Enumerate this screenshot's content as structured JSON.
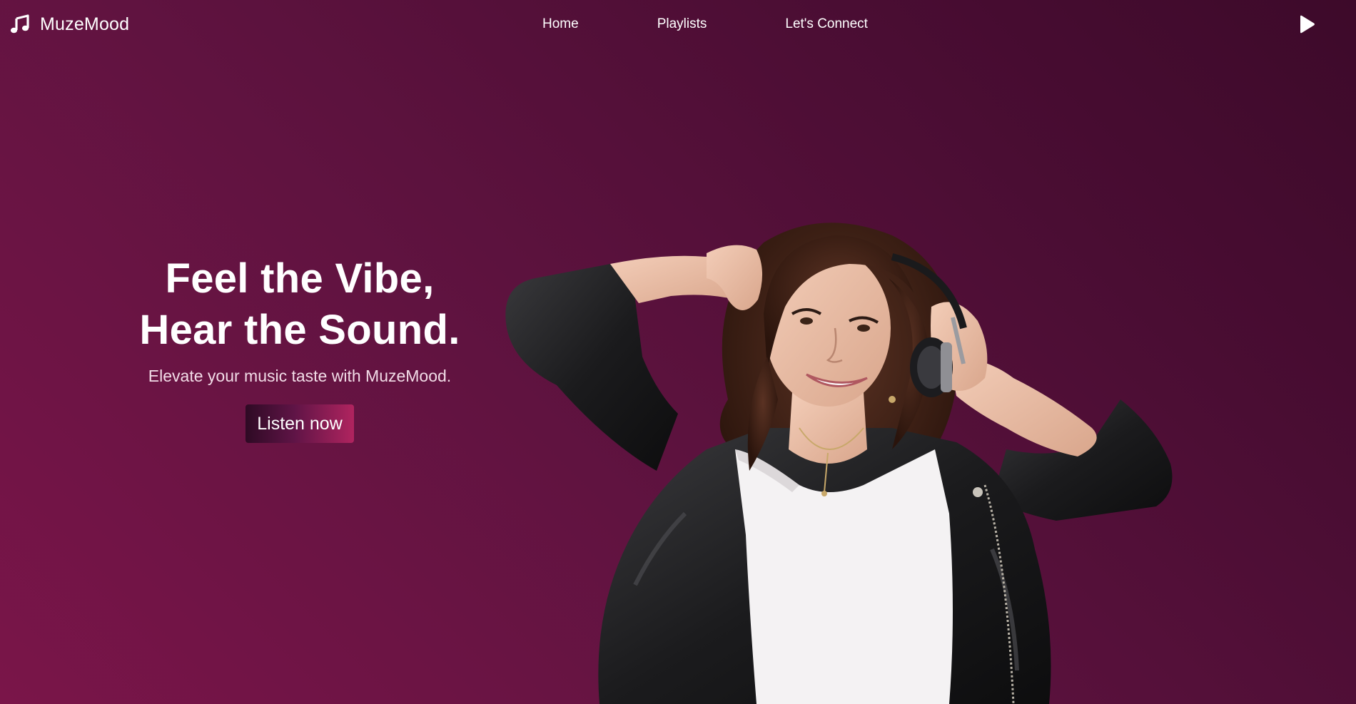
{
  "brand": {
    "name": "MuzeMood",
    "icon": "music-note-icon"
  },
  "nav": {
    "links": [
      {
        "label": "Home"
      },
      {
        "label": "Playlists"
      },
      {
        "label": "Let's Connect"
      }
    ],
    "play_icon": "play-icon"
  },
  "hero": {
    "title_line1": "Feel the Vibe,",
    "title_line2": "Hear the Sound.",
    "subtitle": "Elevate your music taste with MuzeMood.",
    "cta_label": "Listen now",
    "image": "woman-with-headphones-photo"
  },
  "colors": {
    "background_light": "#7a1549",
    "background_dark": "#3d0a2a",
    "cta_start": "#2e0a24",
    "cta_end": "#b0245f",
    "text": "#ffffff"
  }
}
